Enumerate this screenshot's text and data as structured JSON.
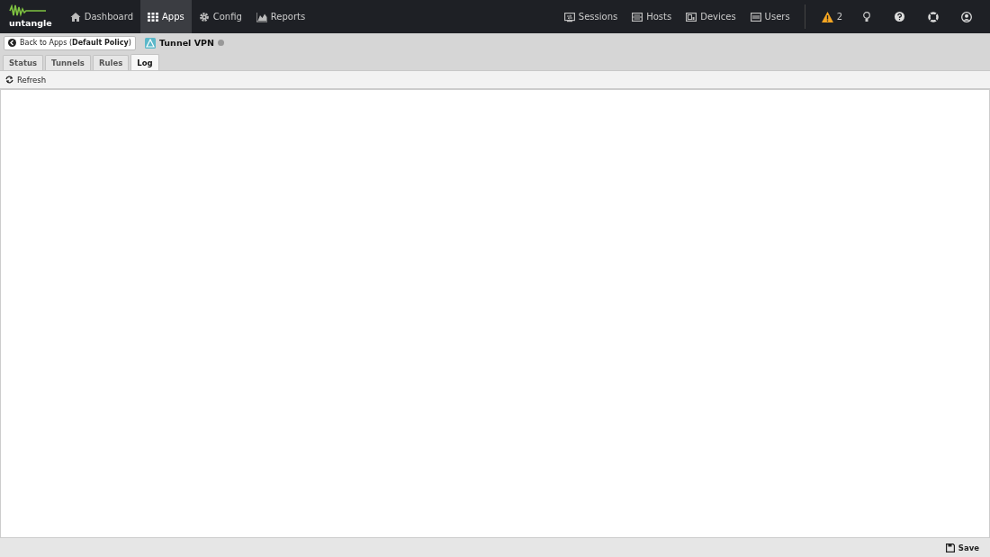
{
  "logo": {
    "text": "untangle"
  },
  "nav": [
    {
      "label": "Dashboard",
      "selected": false
    },
    {
      "label": "Apps",
      "selected": true
    },
    {
      "label": "Config",
      "selected": false
    },
    {
      "label": "Reports",
      "selected": false
    }
  ],
  "nav_right": [
    {
      "label": "Sessions"
    },
    {
      "label": "Hosts"
    },
    {
      "label": "Devices"
    },
    {
      "label": "Users"
    }
  ],
  "alerts": {
    "count": "2"
  },
  "back_button": {
    "label": "Back to Apps (**Default Policy**)"
  },
  "app": {
    "title": "Tunnel VPN",
    "running": false
  },
  "tabs": [
    {
      "label": "Status",
      "selected": false
    },
    {
      "label": "Tunnels",
      "selected": false
    },
    {
      "label": "Rules",
      "selected": false
    },
    {
      "label": "Log",
      "selected": true
    }
  ],
  "toolbar": {
    "refresh": "Refresh"
  },
  "footer": {
    "save": "Save"
  }
}
